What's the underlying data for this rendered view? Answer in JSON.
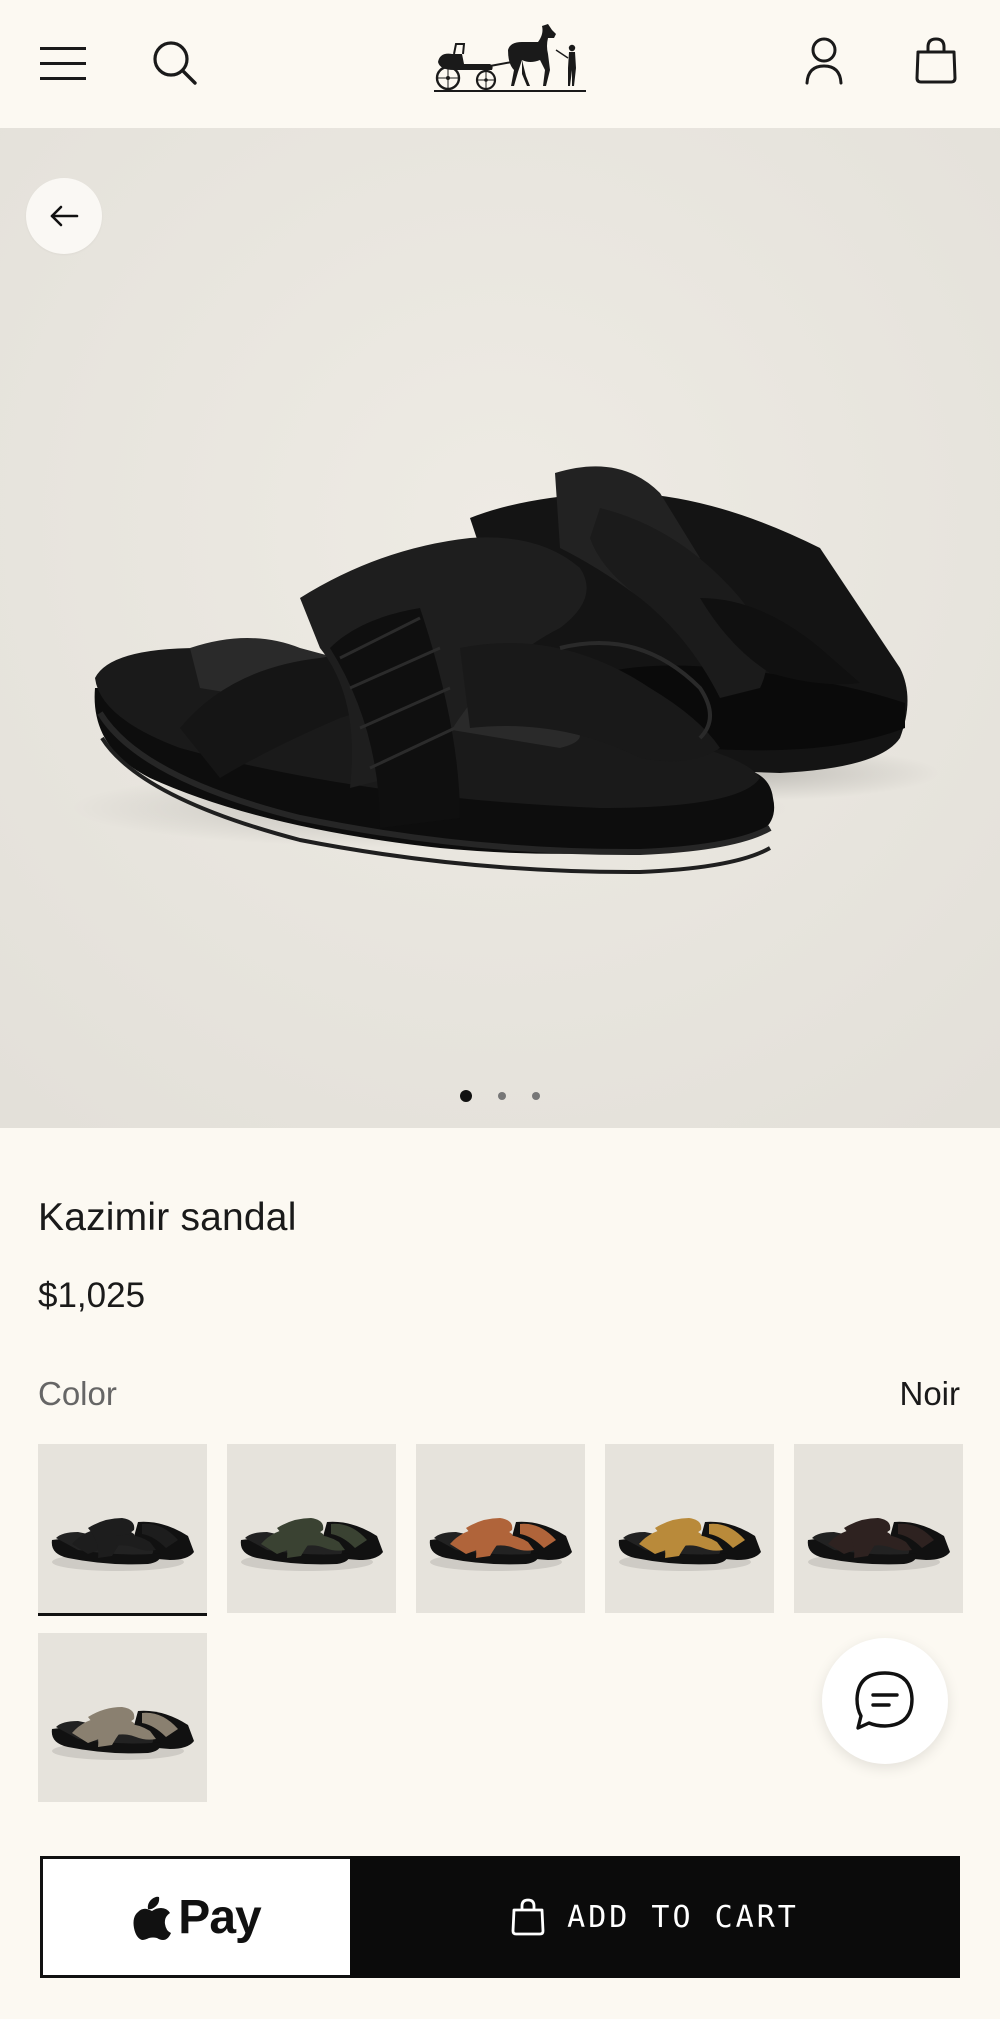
{
  "header": {
    "menu_icon": "hamburger-menu-icon",
    "search_icon": "search-icon",
    "logo_icon": "horse-carriage-logo",
    "account_icon": "person-icon",
    "cart_icon": "shopping-bag-icon"
  },
  "gallery": {
    "back_icon": "arrow-left-icon",
    "image_subject": "black-sandal",
    "page_count": 3,
    "current_page": 1
  },
  "product": {
    "title": "Kazimir sandal",
    "price": "$1,025"
  },
  "color": {
    "label": "Color",
    "selected": "Noir",
    "swatch_tones": [
      "#1d1d1d",
      "#3a4232",
      "#b0643a",
      "#b98a3a",
      "#2e2220",
      "#8a8070"
    ],
    "selected_index": 0
  },
  "chat": {
    "icon": "chat-bubble-icon"
  },
  "actions": {
    "applepay_label": "Pay",
    "apple_icon": "apple-logo-icon",
    "add_to_cart_label": "ADD TO CART",
    "bag_icon": "shopping-bag-icon"
  },
  "colors": {
    "page_bg": "#fcf9f2",
    "hero_bg": "#e9e6df",
    "button_dark": "#0b0b0b"
  }
}
